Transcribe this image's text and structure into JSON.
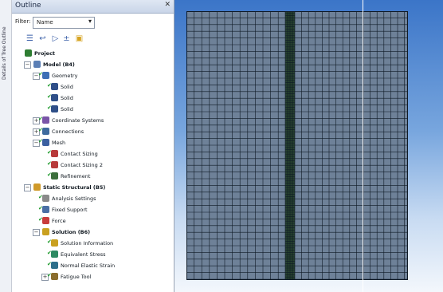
{
  "side_strip": {
    "label": "Details of Tree Outline"
  },
  "outline": {
    "title": "Outline",
    "pin_icon": "pin-icon",
    "filter": {
      "label": "Filter:",
      "value": "Name"
    }
  },
  "toolbar": {
    "icons": [
      "expand-icon",
      "collapse-icon",
      "up-icon",
      "down-icon",
      "lock-icon"
    ]
  },
  "tree": [
    {
      "label": "Project",
      "level": 0,
      "bold": true,
      "icon": "project-icon",
      "expander": ""
    },
    {
      "label": "Model (B4)",
      "level": 1,
      "bold": true,
      "icon": "model-icon",
      "expander": "−"
    },
    {
      "label": "Geometry",
      "level": 2,
      "bold": false,
      "icon": "geometry-icon",
      "expander": "−"
    },
    {
      "label": "Solid",
      "level": 3,
      "bold": false,
      "icon": "solid-icon",
      "expander": ""
    },
    {
      "label": "Solid",
      "level": 3,
      "bold": false,
      "icon": "solid-icon",
      "expander": ""
    },
    {
      "label": "Solid",
      "level": 3,
      "bold": false,
      "icon": "solid-icon",
      "expander": ""
    },
    {
      "label": "Coordinate Systems",
      "level": 2,
      "bold": false,
      "icon": "coordinate-icon",
      "expander": "+"
    },
    {
      "label": "Connections",
      "level": 2,
      "bold": false,
      "icon": "connections-icon",
      "expander": "+"
    },
    {
      "label": "Mesh",
      "level": 2,
      "bold": false,
      "icon": "mesh-icon",
      "expander": "−"
    },
    {
      "label": "Contact Sizing",
      "level": 3,
      "bold": false,
      "icon": "contact-sizing-icon",
      "expander": ""
    },
    {
      "label": "Contact Sizing 2",
      "level": 3,
      "bold": false,
      "icon": "contact-sizing-icon",
      "expander": ""
    },
    {
      "label": "Refinement",
      "level": 3,
      "bold": false,
      "icon": "refinement-icon",
      "expander": ""
    },
    {
      "label": "Static Structural (B5)",
      "level": 1,
      "bold": true,
      "icon": "static-structural-icon",
      "expander": "−"
    },
    {
      "label": "Analysis Settings",
      "level": 2,
      "bold": false,
      "icon": "settings-icon",
      "expander": ""
    },
    {
      "label": "Fixed Support",
      "level": 2,
      "bold": false,
      "icon": "fixed-support-icon",
      "expander": ""
    },
    {
      "label": "Force",
      "level": 2,
      "bold": false,
      "icon": "force-icon",
      "expander": ""
    },
    {
      "label": "Solution (B6)",
      "level": 2,
      "bold": true,
      "icon": "solution-icon",
      "expander": "−"
    },
    {
      "label": "Solution Information",
      "level": 3,
      "bold": false,
      "icon": "info-icon",
      "expander": ""
    },
    {
      "label": "Equivalent Stress",
      "level": 3,
      "bold": false,
      "icon": "stress-icon",
      "expander": ""
    },
    {
      "label": "Normal Elastic Strain",
      "level": 3,
      "bold": false,
      "icon": "strain-icon",
      "expander": ""
    },
    {
      "label": "Fatigue Tool",
      "level": 3,
      "bold": false,
      "icon": "fatigue-icon",
      "expander": "+"
    }
  ],
  "colors": {
    "mesh_fill": "#6e8198",
    "mesh_line": "#0f1a26",
    "dense_band": "#27432f",
    "viewport_top": "#3b75c8",
    "viewport_bottom": "#f3f7fc"
  }
}
